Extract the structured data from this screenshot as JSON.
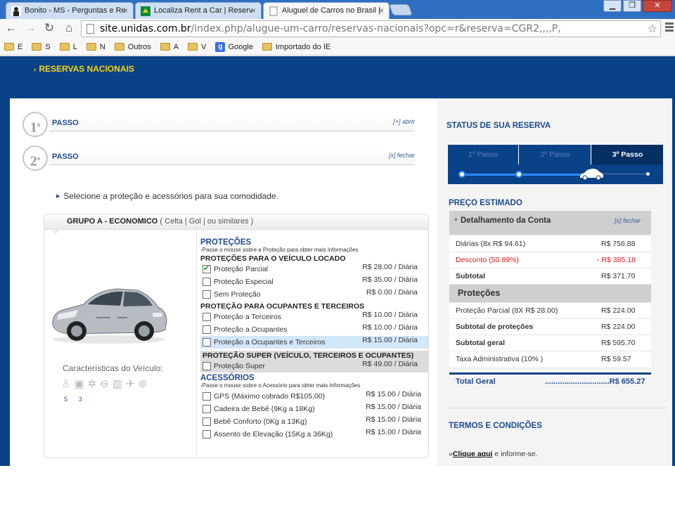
{
  "browser": {
    "tabs": [
      {
        "title": "Bonito - MS - Perguntas e Re",
        "active": false
      },
      {
        "title": "Localiza Rent a Car | Reserv",
        "active": false
      },
      {
        "title": "Aluguel de Carros no Brasil |",
        "active": true
      }
    ],
    "window_buttons": {
      "minimize": "▁",
      "maximize": "❐",
      "close": "✕"
    },
    "address": {
      "host": "site.unidas.com.br",
      "path": "/index.php/alugue-um-carro/reservas-nacionais?opc=r&reserva=CGR2,,,,P,"
    },
    "bookmarks": [
      "E",
      "S",
      "L",
      "N",
      "Outros",
      "A",
      "V",
      "Google",
      "Importado do IE"
    ]
  },
  "page": {
    "nav_title": "RESERVAS NACIONAIS",
    "steps": [
      {
        "num": "1",
        "label": "PASSO",
        "toggle": "[+] abrir"
      },
      {
        "num": "2",
        "label": "PASSO",
        "toggle": "[x] fechar"
      }
    ],
    "instruction": "Selecione a proteção e acessórios para sua comodidade.",
    "group": {
      "name": "GRUPO A - ECONOMICO",
      "similar": "( Celta | Gol | ou similares )",
      "characteristics_label": "Características do Veículo:",
      "char_numbers": [
        "5",
        "3"
      ]
    },
    "protecoes": {
      "title": "PROTEÇÕES",
      "hint": "-Passe o mouse sobre a Proteção para obter mais informações",
      "veiculo_title": "PROTEÇÕES PARA O VEÍCULO LOCADO",
      "veiculo": [
        {
          "label": "Proteção Parcial",
          "price": "R$ 28.00 / Diária",
          "checked": true
        },
        {
          "label": "Proteção Especial",
          "price": "R$ 35.00 / Diária",
          "checked": false
        },
        {
          "label": "Sem Proteção",
          "price": "R$ 0.00 / Diária",
          "checked": false
        }
      ],
      "ocupantes_title": "PROTEÇÃO PARA OCUPANTES E TERCEIROS",
      "ocupantes": [
        {
          "label": "Proteção a Terceiros",
          "price": "R$ 10.00 / Diária",
          "checked": false
        },
        {
          "label": "Proteção a Ocupantes",
          "price": "R$ 10.00 / Diária",
          "checked": false
        },
        {
          "label": "Proteção a Ocupantes e Terceiros",
          "price": "R$ 15.00 / Diária",
          "checked": false
        }
      ],
      "super_title": "PROTEÇÃO SUPER (VEÍCULO, TERCEIROS E OCUPANTES)",
      "super": [
        {
          "label": "Proteção Super",
          "price": "R$ 49.00 / Diária",
          "checked": false
        }
      ]
    },
    "acessorios": {
      "title": "ACESSÓRIOS",
      "hint": "-Passe o mouse sobre o Acessório para obter mais informações",
      "items": [
        {
          "label": "GPS (Máximo cobrado R$105,00)",
          "price": "R$ 15.00 / Diária",
          "checked": false
        },
        {
          "label": "Cadeira de Bebê (9Kg a 18Kg)",
          "price": "R$ 15.00 / Diária",
          "checked": false
        },
        {
          "label": "Bebê Conforto (0Kg a 13Kg)",
          "price": "R$ 15.00 / Diária",
          "checked": false
        },
        {
          "label": "Assento de Elevação (15Kg a 36Kg)",
          "price": "R$ 15.00 / Diária",
          "checked": false
        }
      ]
    }
  },
  "status": {
    "title": "STATUS DE SUA RESERVA",
    "steps": [
      "1º Passo",
      "2º Passo",
      "3º Passo"
    ],
    "active_step": 3
  },
  "preco": {
    "title": "PREÇO ESTIMADO",
    "detail_title": "Detalhamento da Conta",
    "detail_close": "[x] fechar",
    "rows": [
      {
        "label": "Diárias (8x R$ 94.61)",
        "value": "R$ 756.88"
      },
      {
        "label": "Desconto (50.89%)",
        "value": "- R$ 385.18"
      },
      {
        "label": "Subtotal",
        "value": "R$ 371.70"
      },
      {
        "label": "Proteções",
        "value": ""
      },
      {
        "label": "Proteção Parcial (8X R$ 28.00)",
        "value": "R$ 224.00"
      },
      {
        "label": "Subtotal de proteções",
        "value": "R$ 224.00"
      },
      {
        "label": "Subtotal geral",
        "value": "R$ 595.70"
      },
      {
        "label": "Taxa Administrativa (10% )",
        "value": "R$ 59.57"
      }
    ],
    "total_label": "Total Geral",
    "total_value": "..............................R$ 655.27"
  },
  "termos": {
    "title": "TERMOS E CONDIÇÕES",
    "prefix": "»",
    "link": "Clique aqui",
    "suffix": " e informe-se."
  }
}
